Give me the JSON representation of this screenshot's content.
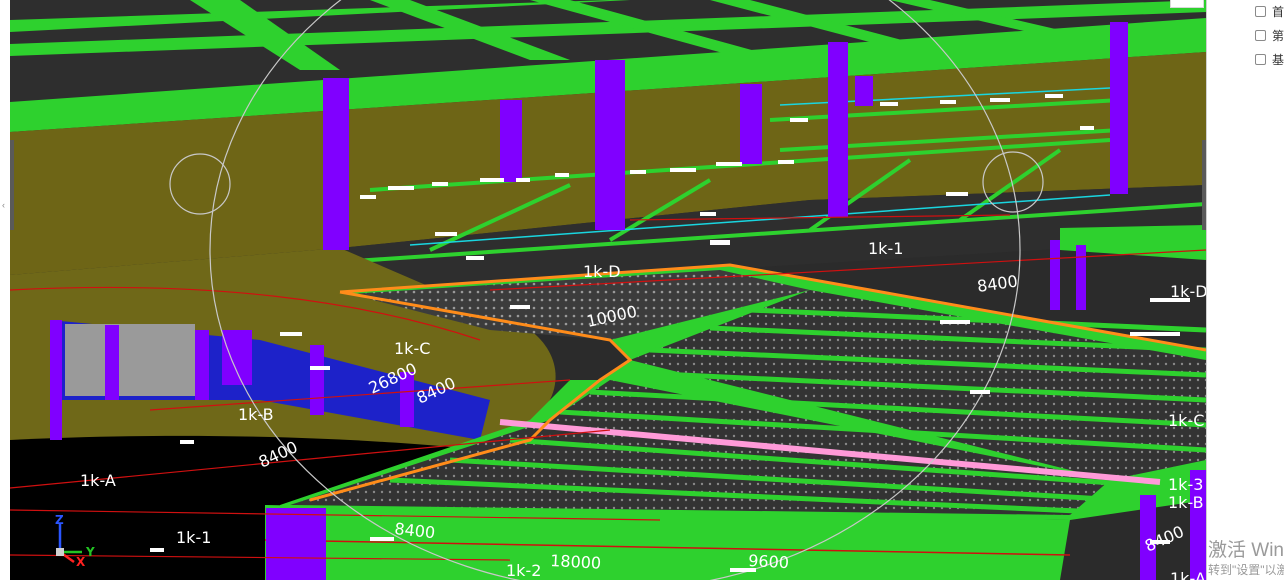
{
  "viewport": {
    "grid_labels": [
      {
        "id": "1k-D",
        "text": "1k-D"
      },
      {
        "id": "1k-C",
        "text": "1k-C"
      },
      {
        "id": "1k-B",
        "text": "1k-B"
      },
      {
        "id": "1k-A",
        "text": "1k-A"
      },
      {
        "id": "1k-1",
        "text": "1k-1"
      },
      {
        "id": "1k-1-top",
        "text": "1k-1"
      },
      {
        "id": "1k-2",
        "text": "1k-2"
      },
      {
        "id": "1k-C-right",
        "text": "1k-C"
      },
      {
        "id": "1k-3-right",
        "text": "1k-3"
      },
      {
        "id": "1k-B-right",
        "text": "1k-B"
      },
      {
        "id": "1k-A-right",
        "text": "1k-A"
      },
      {
        "id": "1k-partial-right",
        "text": "1k-D"
      }
    ],
    "dimensions": [
      {
        "id": "dim-10000",
        "text": "10000"
      },
      {
        "id": "dim-26800",
        "text": "26800"
      },
      {
        "id": "dim-8400-a",
        "text": "8400"
      },
      {
        "id": "dim-8400-b",
        "text": "8400"
      },
      {
        "id": "dim-8400-c",
        "text": "8400"
      },
      {
        "id": "dim-8400-d",
        "text": "8400"
      },
      {
        "id": "dim-8400-e",
        "text": "8400"
      },
      {
        "id": "dim-18000",
        "text": "18000"
      },
      {
        "id": "dim-9600",
        "text": "9600"
      }
    ],
    "axes": {
      "z": "Z",
      "x": "X",
      "y": "Y"
    },
    "colors": {
      "beam_green": "#2ed12e",
      "column_purple": "#8000ff",
      "wall_olive": "#6e6516",
      "slab_dark": "#2e2e2e",
      "grid_red": "#d01010",
      "highlight_pink": "#ff9ad8",
      "orange_edge": "#ff8c1a"
    }
  },
  "layer_panel": {
    "items": [
      {
        "label": "首层",
        "checked": false
      },
      {
        "label": "第二层",
        "checked": false
      },
      {
        "label": "基础",
        "checked": false
      }
    ]
  },
  "watermark": {
    "line1": "激活 Windows",
    "line2": "转到\"设置\"以激活 Windows。"
  }
}
